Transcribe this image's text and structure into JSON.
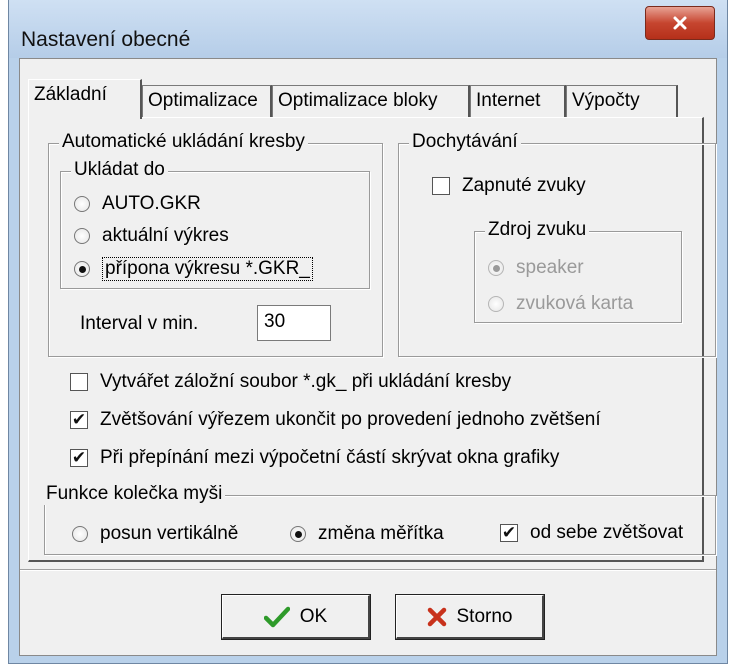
{
  "window": {
    "title": "Nastavení obecné",
    "close_icon": "close-icon"
  },
  "tabs": [
    {
      "label": "Základní",
      "active": true
    },
    {
      "label": "Optimalizace",
      "active": false
    },
    {
      "label": "Optimalizace bloky",
      "active": false
    },
    {
      "label": "Internet",
      "active": false
    },
    {
      "label": "Výpočty",
      "active": false
    }
  ],
  "autosave": {
    "group_label": "Automatické ukládání kresby",
    "save_to": {
      "group_label": "Ukládat do",
      "options": [
        {
          "label": "AUTO.GKR",
          "selected": false
        },
        {
          "label": "aktuální výkres",
          "selected": false
        },
        {
          "label": "přípona výkresu *.GKR_",
          "selected": true
        }
      ]
    },
    "interval_label": "Interval  v min.",
    "interval_value": "30"
  },
  "snapping": {
    "group_label": "Dochytávání",
    "sounds_label": "Zapnuté zvuky",
    "sounds_checked": false,
    "sound_source": {
      "group_label": "Zdroj zvuku",
      "options": [
        {
          "label": "speaker",
          "selected": true
        },
        {
          "label": "zvuková karta",
          "selected": false
        }
      ]
    }
  },
  "options": [
    {
      "label": "Vytvářet záložní soubor *.gk_ při ukládání kresby",
      "checked": false
    },
    {
      "label": "Zvětšování výřezem ukončit po provedení jednoho zvětšení",
      "checked": true
    },
    {
      "label": "Při přepínání mezi výpočetní částí skrývat okna grafiky",
      "checked": true
    }
  ],
  "mouse_wheel": {
    "group_label": "Funkce kolečka myši",
    "vertical_label": "posun vertikálně",
    "vertical_selected": false,
    "scale_label": "změna měřítka",
    "scale_selected": true,
    "zoom_away_label": "od sebe zvětšovat",
    "zoom_away_checked": true
  },
  "buttons": {
    "ok_label": "OK",
    "ok_icon": "checkmark-icon",
    "ok_color": "#2e9a2a",
    "cancel_label": "Storno",
    "cancel_icon": "cross-icon",
    "cancel_color": "#c8321c"
  }
}
